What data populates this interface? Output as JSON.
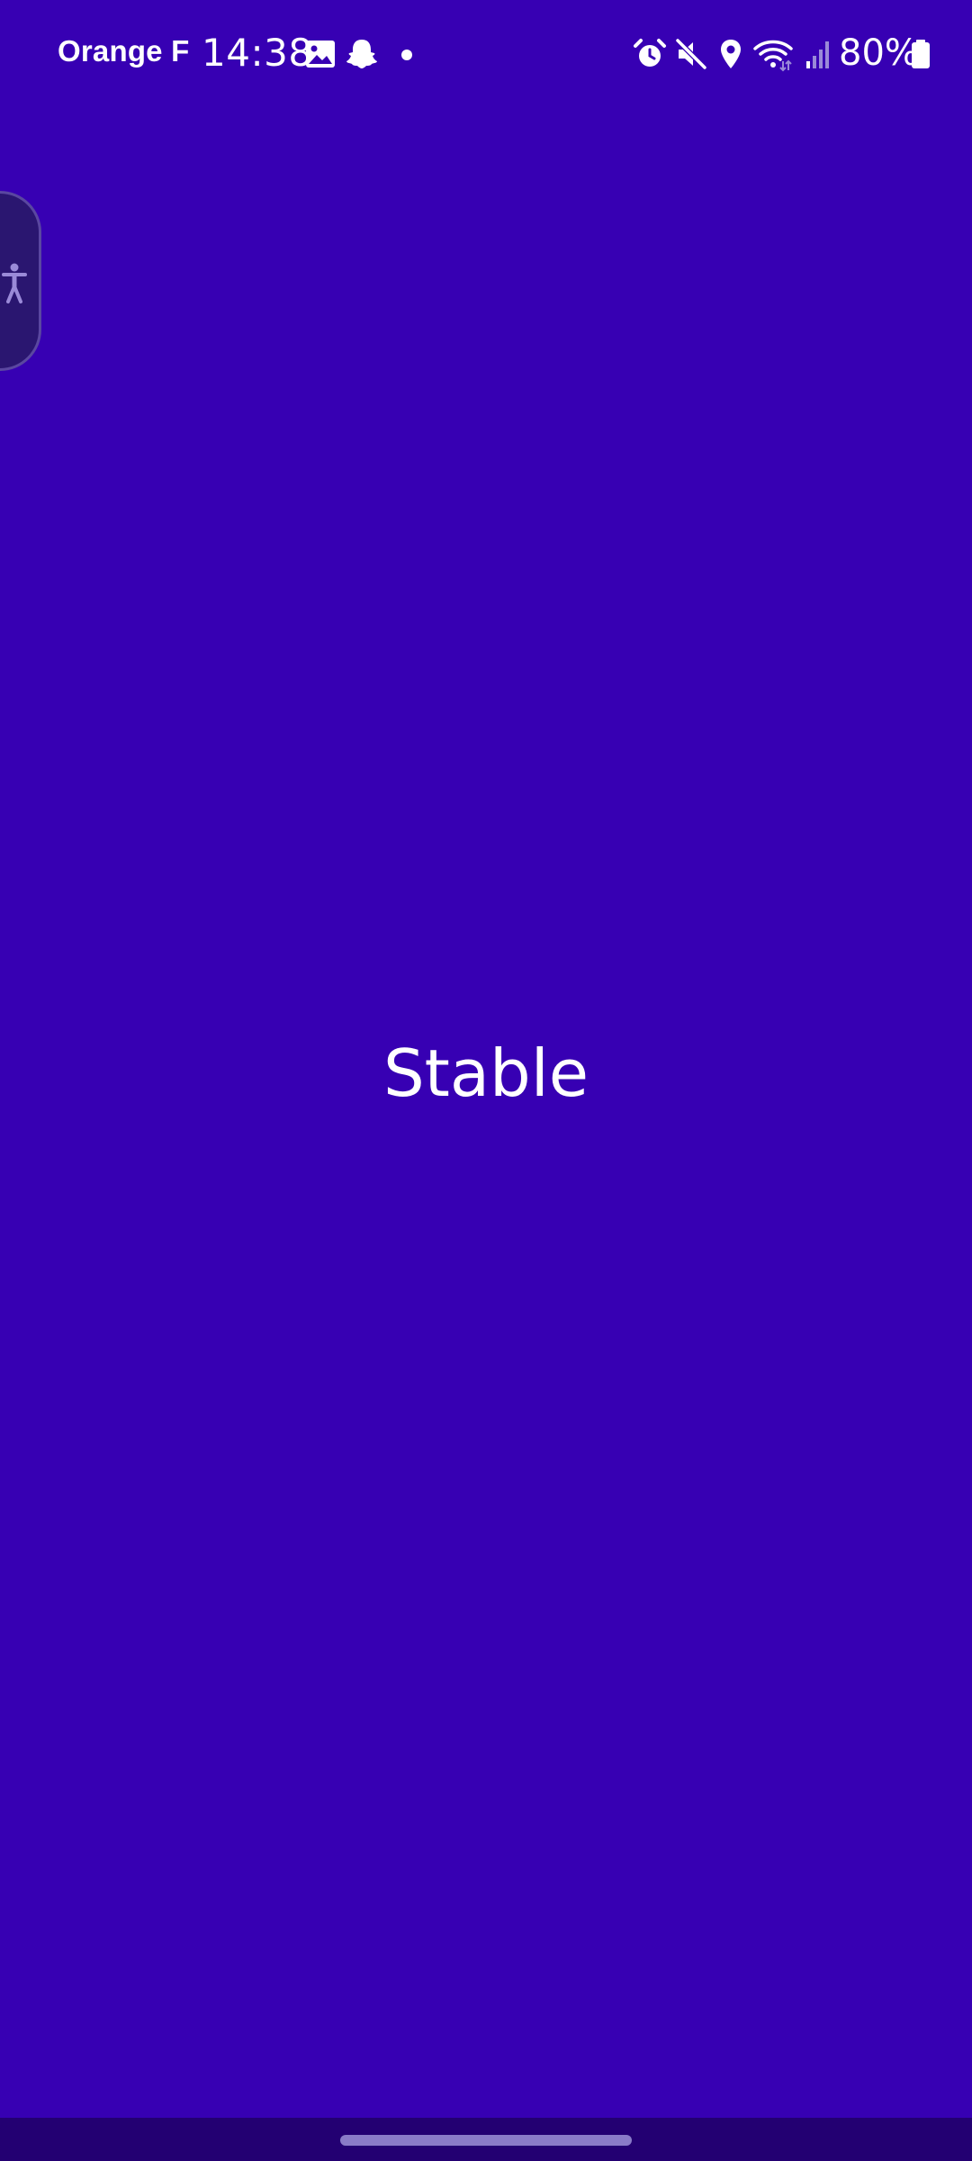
{
  "status_bar": {
    "carrier": "Orange F",
    "time": "14:38",
    "notification_icons": [
      "gallery-icon",
      "snapchat-icon",
      "dot-icon"
    ],
    "system_icons": [
      "alarm-icon",
      "mute-icon",
      "location-icon",
      "wifi-icon",
      "signal-icon"
    ],
    "battery_percent": "80%"
  },
  "accessibility_handle": {
    "icon": "accessibility-person-icon"
  },
  "main": {
    "label": "Stable"
  },
  "colors": {
    "background": "#3700B3",
    "nav_bar": "#230072",
    "handle": "#2A1670",
    "text": "#FFFFFF"
  }
}
